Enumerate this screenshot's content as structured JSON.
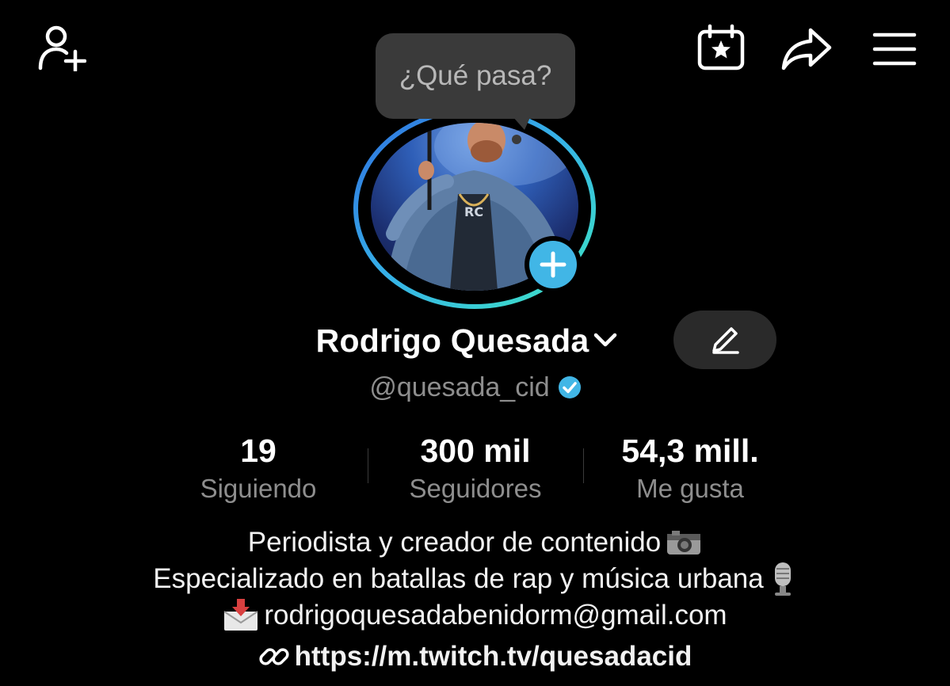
{
  "header": {
    "add_friend_icon": "person-plus-icon",
    "calendar_icon": "calendar-star-icon",
    "share_icon": "share-arrow-icon",
    "menu_icon": "hamburger-menu-icon"
  },
  "bubble": {
    "text": "¿Qué pasa?"
  },
  "profile": {
    "name": "Rodrigo Quesada",
    "handle": "@quesada_cid",
    "verified": true,
    "accent_color": "#41b6e6"
  },
  "stats": [
    {
      "value": "19",
      "label": "Siguiendo"
    },
    {
      "value": "300 mil",
      "label": "Seguidores"
    },
    {
      "value": "54,3 mill.",
      "label": "Me gusta"
    }
  ],
  "bio": {
    "line1": "Periodista y creador de contenido",
    "line1_emoji": "camera-icon",
    "line2": "Especializado en batallas de rap y música urbana",
    "line2_emoji": "microphone-icon",
    "line3": "rodrigoquesadabenidorm@gmail.com",
    "line3_emoji": "inbox-tray-icon",
    "link": "https://m.twitch.tv/quesadacid"
  }
}
